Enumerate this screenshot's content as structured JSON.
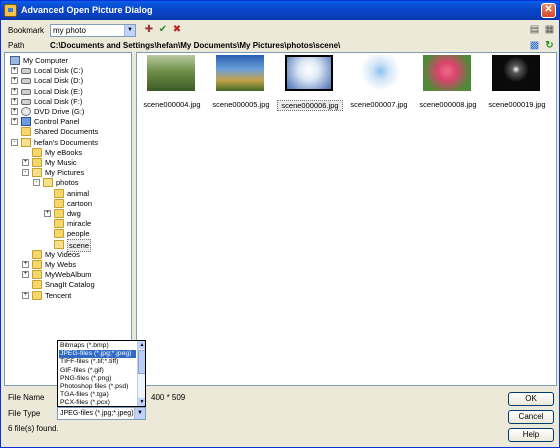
{
  "window": {
    "title": "Advanced Open Picture Dialog"
  },
  "bookmark": {
    "label": "Bookmark",
    "value": "my photo"
  },
  "path": {
    "label": "Path",
    "value": "C:\\Documents and Settings\\hefan\\My Documents\\My Pictures\\photos\\scene\\"
  },
  "tree": {
    "items": [
      {
        "label": "My Computer",
        "icon": "computer-icon"
      },
      {
        "label": "Local Disk (C:)",
        "icon": "drive-icon"
      },
      {
        "label": "Local Disk (D:)",
        "icon": "drive-icon"
      },
      {
        "label": "Local Disk (E:)",
        "icon": "drive-icon"
      },
      {
        "label": "Local Disk (F:)",
        "icon": "drive-icon"
      },
      {
        "label": "DVD Drive (G:)",
        "icon": "cd-icon"
      },
      {
        "label": "Control Panel",
        "icon": "control-panel-icon"
      },
      {
        "label": "Shared Documents",
        "icon": "folder-icon"
      },
      {
        "label": "hefan's Documents",
        "icon": "folder-open-icon"
      },
      {
        "label": "My eBooks",
        "icon": "folder-icon"
      },
      {
        "label": "My Music",
        "icon": "folder-icon"
      },
      {
        "label": "My Pictures",
        "icon": "folder-open-icon"
      },
      {
        "label": "photos",
        "icon": "folder-open-icon"
      },
      {
        "label": "animal",
        "icon": "folder-icon"
      },
      {
        "label": "cartoon",
        "icon": "folder-icon"
      },
      {
        "label": "dwg",
        "icon": "folder-icon"
      },
      {
        "label": "miracle",
        "icon": "folder-icon"
      },
      {
        "label": "people",
        "icon": "folder-icon"
      },
      {
        "label": "scene",
        "icon": "folder-open-icon"
      },
      {
        "label": "My Videos",
        "icon": "folder-icon"
      },
      {
        "label": "My Webs",
        "icon": "folder-icon"
      },
      {
        "label": "MyWebAlbum",
        "icon": "folder-icon"
      },
      {
        "label": "SnagIt Catalog",
        "icon": "folder-icon"
      },
      {
        "label": "Tencent",
        "icon": "folder-icon"
      }
    ]
  },
  "thumbnails": [
    {
      "name": "scene000004.jpg"
    },
    {
      "name": "scene000005.jpg"
    },
    {
      "name": "scene000006.jpg"
    },
    {
      "name": "scene000007.jpg"
    },
    {
      "name": "scene000008.jpg"
    },
    {
      "name": "scene000019.jpg"
    }
  ],
  "file_type_options": [
    "Bitmaps (*.bmp)",
    "JPEG-files (*.jpg;*.jpeg)",
    "TIFF-files (*.tif;*.tiff)",
    "GIF-files (*.gif)",
    "PNG-files (*.png)",
    "Photoshop files (*.psd)",
    "TGA-files (*.tga)",
    "PCX-files (*.pcx)"
  ],
  "file_name": {
    "label": "File Name",
    "size_info": "400 * 509"
  },
  "file_type": {
    "label": "File Type",
    "value": "JPEG-files (*.jpg;*.jpeg)"
  },
  "status": {
    "text": "6 file(s) found."
  },
  "buttons": {
    "ok": "OK",
    "cancel": "Cancel",
    "help": "Help"
  },
  "colors": {
    "title_bar": "#0a4fd6",
    "selection": "#316ac5"
  }
}
